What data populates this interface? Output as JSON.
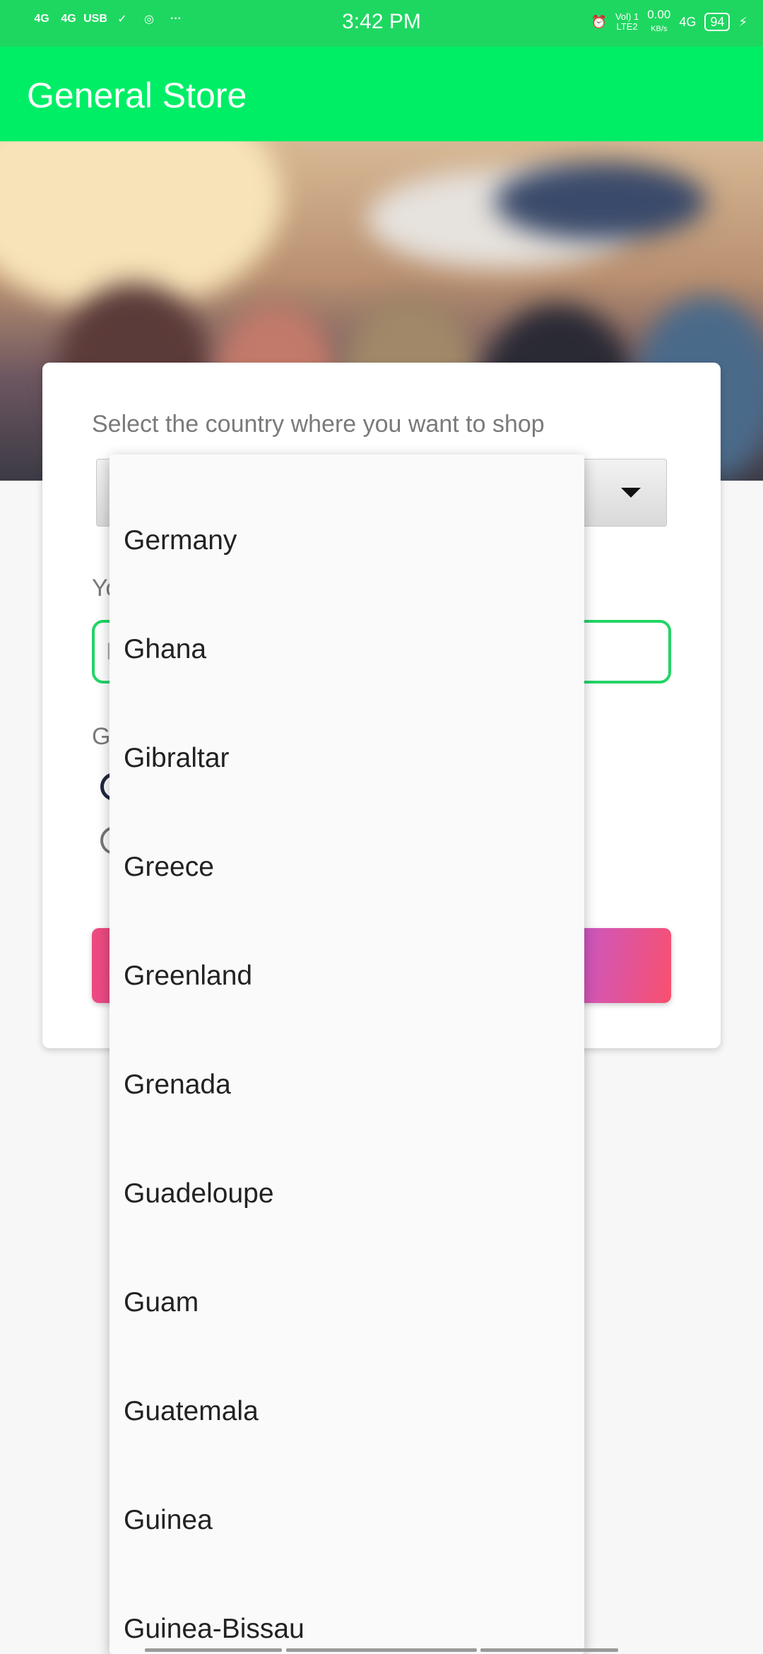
{
  "status_bar": {
    "time": "3:42 PM",
    "left_icons": [
      "4G",
      "4G",
      "USB",
      "✓",
      "◎",
      "···"
    ],
    "net_speed": "0.00",
    "net_unit": "KB/s",
    "volte": "Vol) 1",
    "lte": "LTE2",
    "signal": "4G",
    "battery": "94"
  },
  "app_bar": {
    "title": "General Store"
  },
  "form": {
    "country_label": "Select the country where you want to shop",
    "name_label_partial": "Yo",
    "name_hint_partial": "E",
    "gender_label_partial": "G"
  },
  "dropdown": {
    "items": [
      "Germany",
      "Ghana",
      "Gibraltar",
      "Greece",
      "Greenland",
      "Grenada",
      "Guadeloupe",
      "Guam",
      "Guatemala",
      "Guinea",
      "Guinea-Bissau"
    ]
  },
  "colors": {
    "status_bar": "#1ed760",
    "app_bar": "#00ee66",
    "accent": "#22d566"
  }
}
